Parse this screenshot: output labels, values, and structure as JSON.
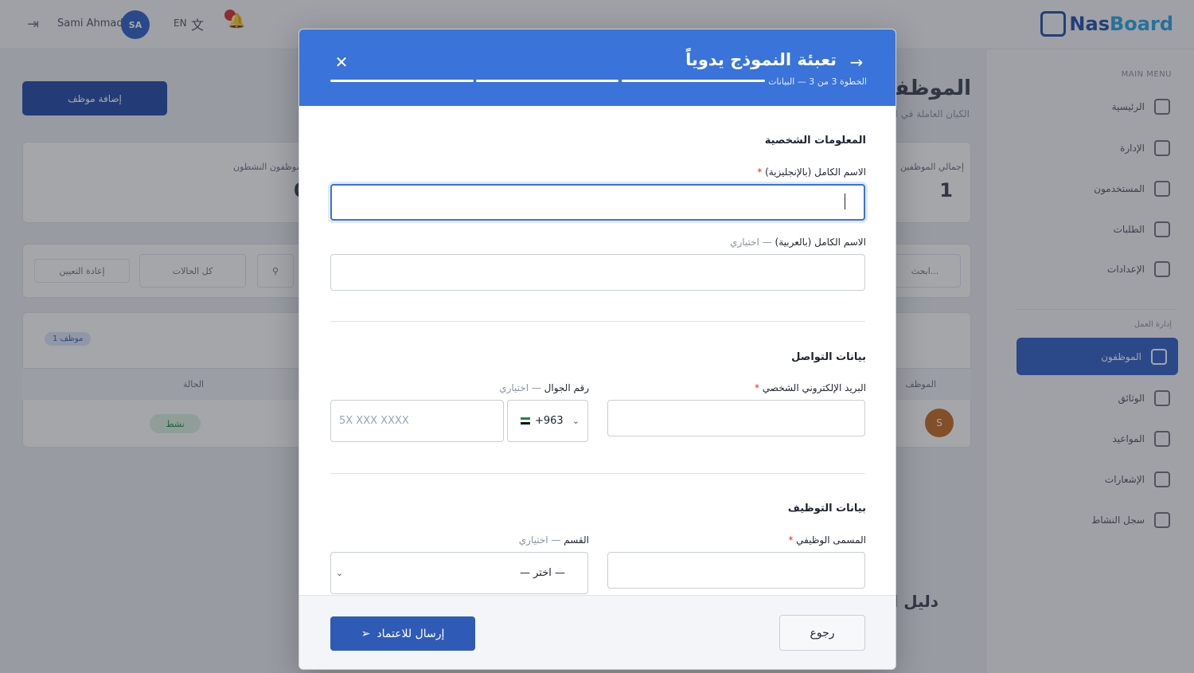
{
  "background": {
    "topbar": {
      "user_name": "Sami Ahmad",
      "avatar_initials": "SA",
      "language": "EN",
      "logo_part1": "Nas",
      "logo_part2": "Board"
    },
    "sidebar": {
      "section_main": "MAIN MENU",
      "section_work": "إدارة العمل",
      "items_main": [
        "الرئيسية",
        "الإدارة",
        "المستخدمون",
        "الطلبات",
        "الإعدادات"
      ],
      "active_item": "الموظفون",
      "items_work": [
        "الوثائق",
        "المواعيد",
        "الإشعارات",
        "سجل النشاط"
      ]
    },
    "main": {
      "page_title": "الموظفون",
      "page_subtitle": "الكيان العاملة في النظام",
      "add_button": "إضافة موظف",
      "stat_total_label": "إجمالي الموظفين",
      "stat_total_value": "1",
      "stat_other_label": "الموظفون النشطون",
      "stat_other_value": "0",
      "filter_all": "كل الحالات",
      "filter_reset": "إعادة التعيين",
      "search_placeholder": "ابحث...",
      "directory_title": "دليل الموظفين",
      "count_badge": "1 موظف",
      "col_employee": "الموظف",
      "col_status": "الحالة",
      "row_avatar": "S",
      "row_status": "نشط"
    }
  },
  "modal": {
    "title": "تعبئة النموذج يدوياً",
    "step_text": "الخطوة 3 من 3 — البيانات",
    "progress_steps": 3,
    "progress_current": 3,
    "icons": {
      "back": "arrow-right-icon",
      "close": "close-icon"
    },
    "sections": {
      "personal": "المعلومات الشخصية",
      "contact": "بيانات التواصل",
      "employment": "بيانات التوظيف"
    },
    "fields": {
      "name_en_label": "الاسم الكامل (بالإنجليزية)",
      "name_en_value": "",
      "name_ar_label": "الاسم الكامل (بالعربية)",
      "name_ar_value": "",
      "email_label": "البريد الإلكتروني الشخصي",
      "email_value": "",
      "phone_label": "رقم الجوال",
      "phone_placeholder": "5X XXX XXXX",
      "country_code": "+963",
      "job_title_label": "المسمى الوظيفي",
      "job_title_value": "",
      "department_label": "القسم",
      "department_selected": "— اختر —",
      "optional_suffix": "— اختياري",
      "required_mark": "*"
    },
    "footer": {
      "submit_label": "إرسال للاعتماد",
      "back_label": "رجوع"
    }
  },
  "colors": {
    "header_blue": "#3a73d9",
    "submit_blue": "#2f5bb7",
    "required_red": "#d92d2d"
  }
}
